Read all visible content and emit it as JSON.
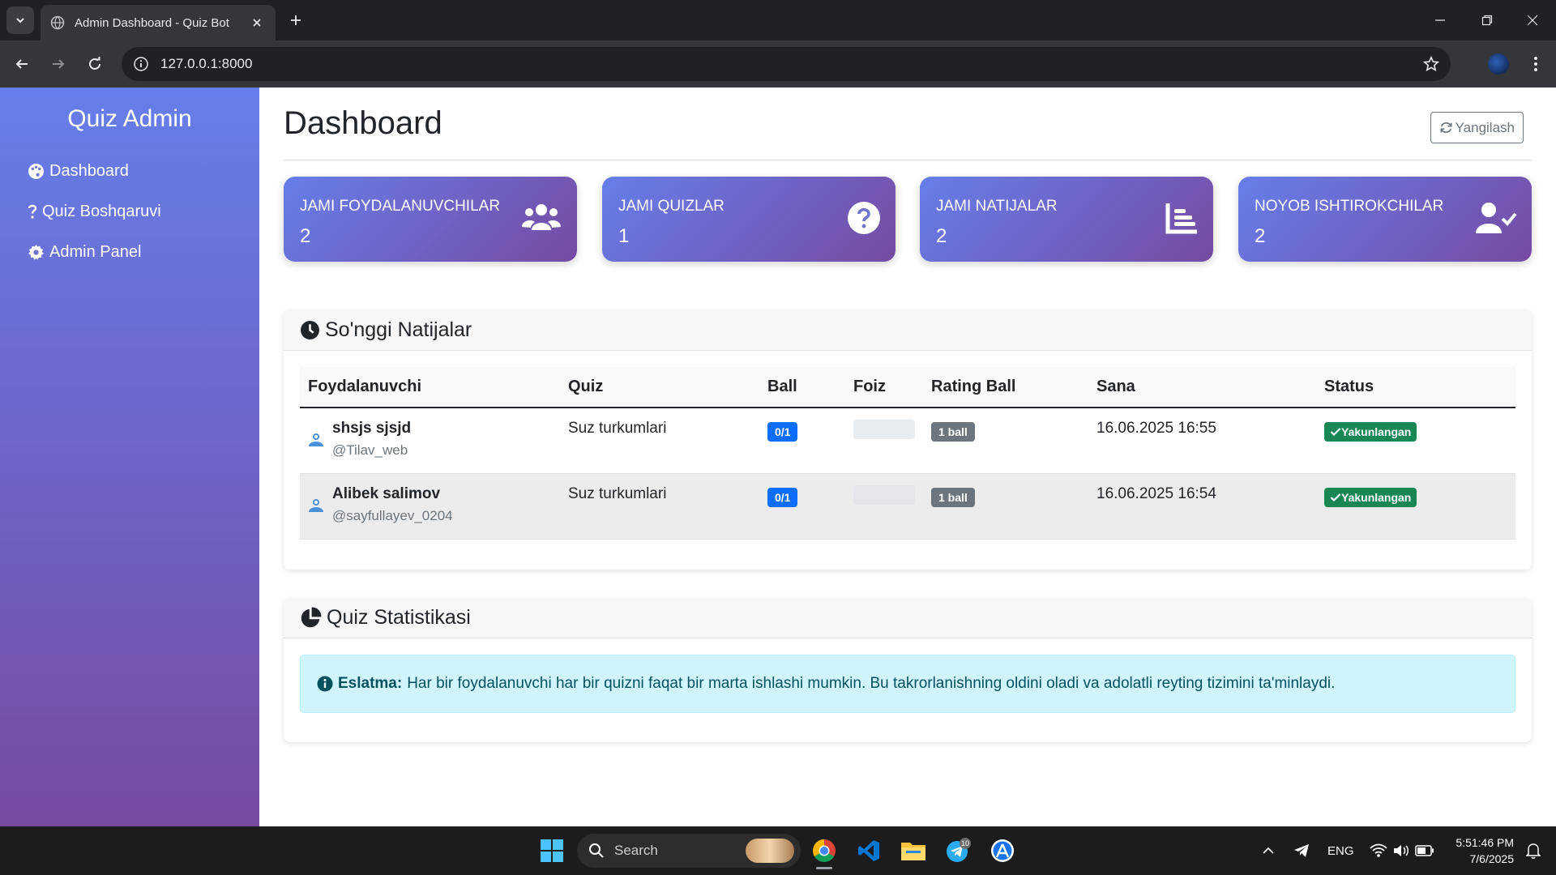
{
  "browser": {
    "tab_title": "Admin Dashboard - Quiz Bot",
    "url": "127.0.0.1:8000"
  },
  "sidebar": {
    "brand": "Quiz Admin",
    "items": [
      {
        "label": "Dashboard",
        "icon": "palette-icon"
      },
      {
        "label": "Quiz Boshqaruvi",
        "icon": "question-icon"
      },
      {
        "label": "Admin Panel",
        "icon": "gear-icon"
      }
    ]
  },
  "header": {
    "title": "Dashboard",
    "refresh_label": "Yangilash"
  },
  "stats": [
    {
      "label": "JAMI FOYDALANUVCHILAR",
      "value": "2",
      "icon": "users-icon"
    },
    {
      "label": "JAMI QUIZLAR",
      "value": "1",
      "icon": "question-circle-icon"
    },
    {
      "label": "JAMI NATIJALAR",
      "value": "2",
      "icon": "bar-chart-icon"
    },
    {
      "label": "NOYOB ISHTIROKCHILAR",
      "value": "2",
      "icon": "user-check-icon"
    }
  ],
  "results": {
    "title": "So'nggi Natijalar",
    "columns": [
      "Foydalanuvchi",
      "Quiz",
      "Ball",
      "Foiz",
      "Rating Ball",
      "Sana",
      "Status"
    ],
    "rows": [
      {
        "name": "shsjs sjsjd",
        "handle": "@Tilav_web",
        "quiz": "Suz turkumlari",
        "ball": "0/1",
        "foiz": 0,
        "rating": "1 ball",
        "sana": "16.06.2025 16:55",
        "status": "Yakunlangan"
      },
      {
        "name": "Alibek salimov",
        "handle": "@sayfullayev_0204",
        "quiz": "Suz turkumlari",
        "ball": "0/1",
        "foiz": 0,
        "rating": "1 ball",
        "sana": "16.06.2025 16:54",
        "status": "Yakunlangan"
      }
    ]
  },
  "stats_section": {
    "title": "Quiz Statistikasi",
    "alert_label": "Eslatma:",
    "alert_text": "Har bir foydalanuvchi har bir quizni faqat bir marta ishlashi mumkin. Bu takrorlanishning oldini oladi va adolatli reyting tizimini ta'minlaydi."
  },
  "taskbar": {
    "search_placeholder": "Search",
    "telegram_badge": "10",
    "language": "ENG",
    "time": "5:51:46 PM",
    "date": "7/6/2025"
  },
  "colors": {
    "gradient_start": "#667eea",
    "gradient_end": "#764ba2",
    "primary": "#0d6efd",
    "success": "#198754",
    "secondary": "#6c757d"
  }
}
